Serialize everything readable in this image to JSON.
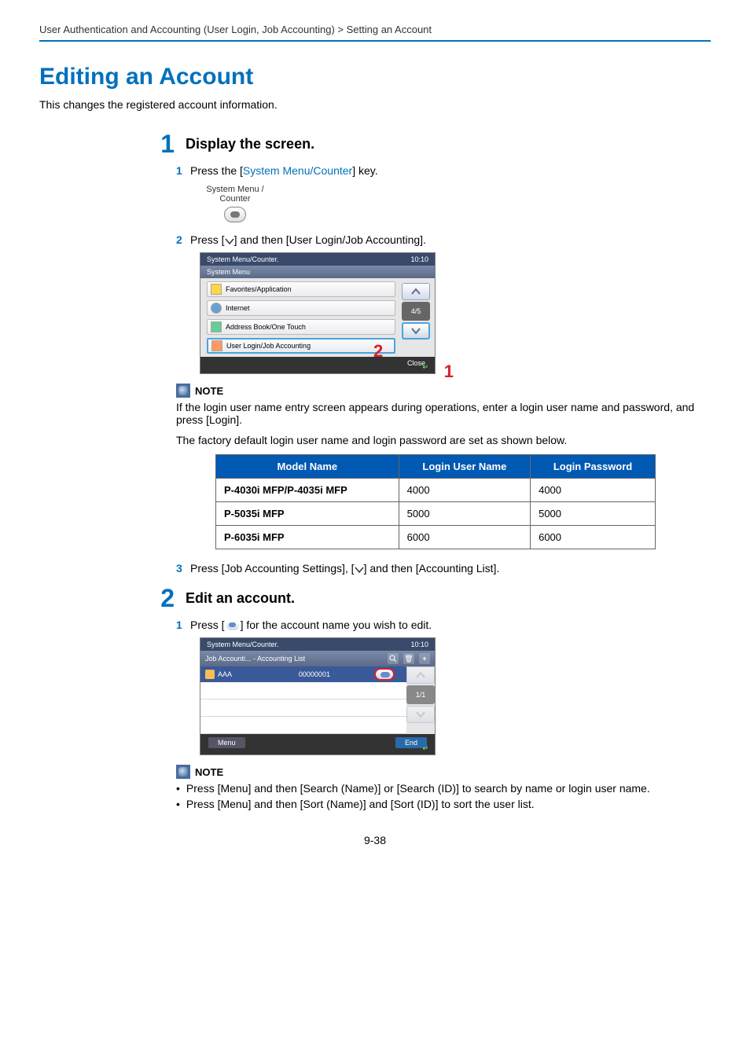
{
  "breadcrumb": "User Authentication and Accounting (User Login, Job Accounting) > Setting an Account",
  "h1": "Editing an Account",
  "intro": "This changes the registered account information.",
  "step1": {
    "num": "1",
    "title": "Display the screen.",
    "s1_num": "1",
    "s1_pre": "Press the [",
    "s1_link": "System Menu/Counter",
    "s1_post": "] key.",
    "key_line1": "System Menu /",
    "key_line2": "Counter",
    "s2_num": "2",
    "s2_text": "Press [      ] and then [User Login/Job Accounting].",
    "screen": {
      "title": "System Menu/Counter.",
      "time": "10:10",
      "bar": "System Menu",
      "items": [
        "Favorites/Application",
        "Internet",
        "Address Book/One Touch",
        "User Login/Job Accounting"
      ],
      "page": "4/5",
      "close": "Close",
      "callout1": "1",
      "callout2": "2"
    },
    "note_label": "NOTE",
    "note_p1": "If the login user name entry screen appears during operations, enter a login user name and password, and press [Login].",
    "note_p2": "The factory default login user name and login password are set as shown below.",
    "table": {
      "h1": "Model Name",
      "h2": "Login User Name",
      "h3": "Login Password",
      "rows": [
        {
          "m": "P-4030i MFP/P-4035i MFP",
          "u": "4000",
          "p": "4000"
        },
        {
          "m": "P-5035i MFP",
          "u": "5000",
          "p": "5000"
        },
        {
          "m": "P-6035i MFP",
          "u": "6000",
          "p": "6000"
        }
      ]
    },
    "s3_num": "3",
    "s3_text": "Press [Job Accounting Settings], [      ] and then [Accounting List]."
  },
  "step2": {
    "num": "2",
    "title": "Edit an account.",
    "s1_num": "1",
    "s1_pre": "Press [",
    "s1_post": "] for the account name you wish to edit.",
    "screen": {
      "title": "System Menu/Counter.",
      "time": "10:10",
      "bar": "Job Accounti... - Accounting List",
      "row_name": "AAA",
      "row_id": "00000001",
      "page": "1/1",
      "menu": "Menu",
      "end": "End"
    },
    "note_label": "NOTE",
    "b1": "Press [Menu] and then [Search (Name)] or [Search (ID)] to search by name or login user name.",
    "b2": "Press [Menu] and then [Sort (Name)] and [Sort (ID)] to sort the user list."
  },
  "page_num": "9-38"
}
